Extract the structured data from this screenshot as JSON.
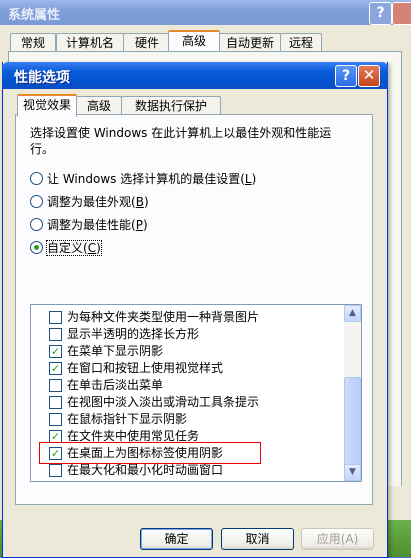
{
  "outer": {
    "title": "系统属性",
    "help_glyph": "?",
    "tabs": [
      "常规",
      "计算机名",
      "硬件",
      "高级",
      "自动更新",
      "远程"
    ],
    "active_tab": "高级"
  },
  "dialog": {
    "title": "性能选项",
    "help_glyph": "?",
    "close_glyph": "✕",
    "tabs": [
      "视觉效果",
      "高级",
      "数据执行保护"
    ],
    "active_tab": "视觉效果",
    "description": "选择设置使 Windows 在此计算机上以最佳外观和性能运行。",
    "radios": [
      {
        "text": "让 Windows 选择计算机的最佳设置",
        "key": "L",
        "selected": false
      },
      {
        "text": "调整为最佳外观",
        "key": "B",
        "selected": false
      },
      {
        "text": "调整为最佳性能",
        "key": "P",
        "selected": false
      },
      {
        "text": "自定义",
        "key": "C",
        "selected": true
      }
    ],
    "effects": [
      {
        "label": "为每种文件夹类型使用一种背景图片",
        "checked": false
      },
      {
        "label": "显示半透明的选择长方形",
        "checked": false
      },
      {
        "label": "在菜单下显示阴影",
        "checked": true
      },
      {
        "label": "在窗口和按钮上使用视觉样式",
        "checked": true
      },
      {
        "label": "在单击后淡出菜单",
        "checked": false
      },
      {
        "label": "在视图中淡入淡出或滑动工具条提示",
        "checked": false
      },
      {
        "label": "在鼠标指针下显示阴影",
        "checked": false
      },
      {
        "label": "在文件夹中使用常见任务",
        "checked": true
      },
      {
        "label": "在桌面上为图标标签使用阴影",
        "checked": true,
        "highlighted": true
      },
      {
        "label": "在最大化和最小化时动画窗口",
        "checked": false
      }
    ],
    "check_glyph": "✓",
    "scroll_up_glyph": "▲",
    "scroll_down_glyph": "▼",
    "buttons": {
      "ok": "确定",
      "cancel": "取消",
      "apply": "应用(A)"
    }
  },
  "colors": {
    "highlight_border": "#e00000",
    "title_blue": "#0453d0",
    "check_green": "#21a121"
  }
}
